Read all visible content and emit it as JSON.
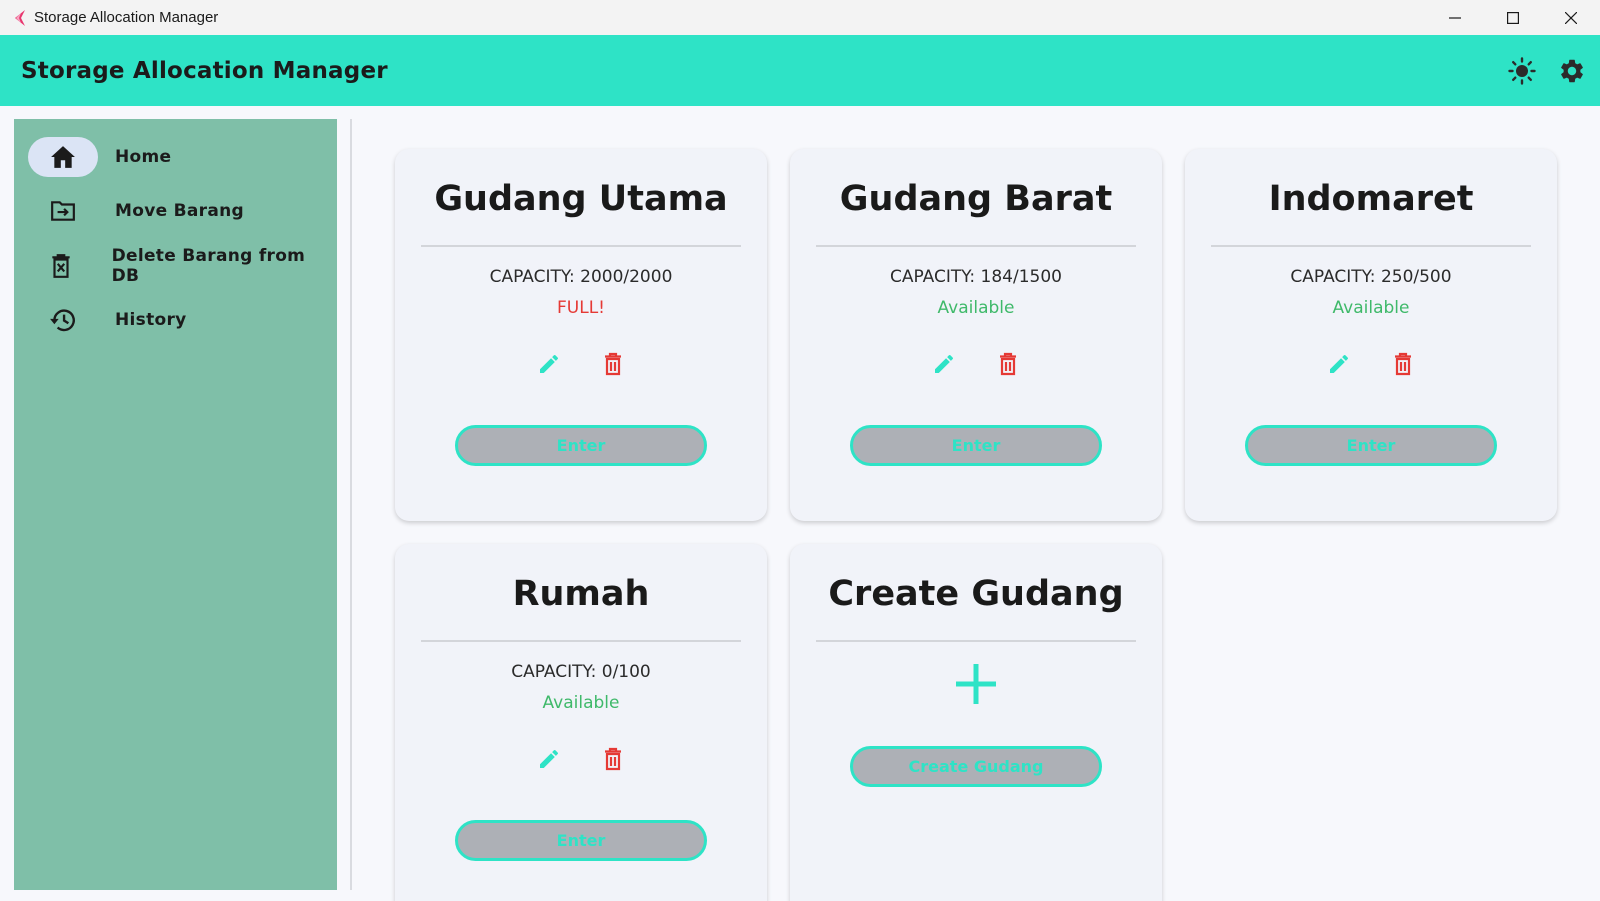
{
  "window": {
    "title": "Storage Allocation Manager",
    "controls": [
      "minimize-icon",
      "maximize-icon",
      "close-icon"
    ]
  },
  "appbar": {
    "title": "Storage Allocation Manager",
    "actions": [
      "brightness-icon",
      "gear-icon"
    ]
  },
  "colors": {
    "accent": "#2ee3c6",
    "sidebar": "#7fbfa8",
    "danger": "#e53935",
    "success": "#3fb96a",
    "button_fill": "#adb0b6"
  },
  "sidebar": {
    "items": [
      {
        "label": "Home",
        "icon": "home-icon",
        "active": true
      },
      {
        "label": "Move Barang",
        "icon": "folder-move-icon",
        "active": false
      },
      {
        "label": "Delete Barang from DB",
        "icon": "delete-outline-icon",
        "active": false
      },
      {
        "label": "History",
        "icon": "history-icon",
        "active": false
      }
    ]
  },
  "gudangs": [
    {
      "name": "Gudang Utama",
      "capacity": "CAPACITY: 2000/2000",
      "status": "FULL!",
      "status_type": "full",
      "button": "Enter"
    },
    {
      "name": "Gudang Barat",
      "capacity": "CAPACITY: 184/1500",
      "status": "Available",
      "status_type": "ok",
      "button": "Enter"
    },
    {
      "name": "Indomaret",
      "capacity": "CAPACITY: 250/500",
      "status": "Available",
      "status_type": "ok",
      "button": "Enter"
    },
    {
      "name": "Rumah",
      "capacity": "CAPACITY: 0/100",
      "status": "Available",
      "status_type": "ok",
      "button": "Enter"
    }
  ],
  "create_card": {
    "title": "Create Gudang",
    "icon": "plus-icon",
    "button": "Create Gudang"
  }
}
